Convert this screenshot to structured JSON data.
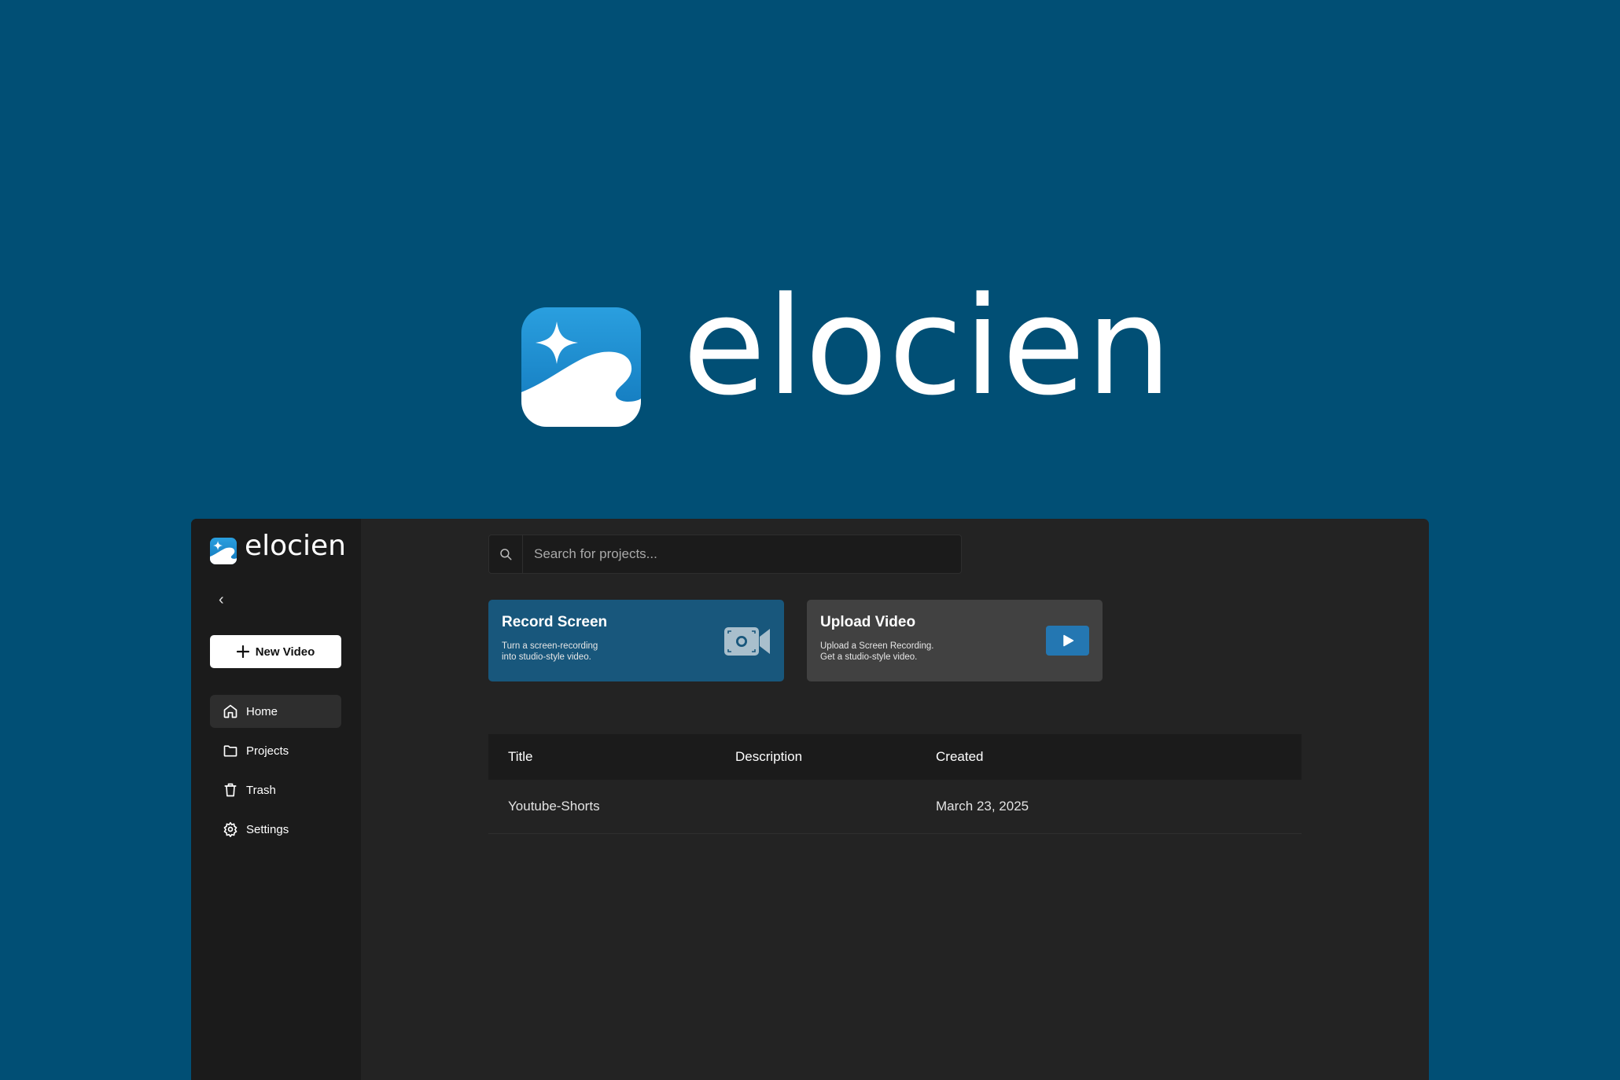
{
  "hero": {
    "brand": "elocien"
  },
  "sidebar": {
    "brand": "elocien",
    "collapse_glyph": "‹",
    "new_video_label": "New Video",
    "items": [
      {
        "label": "Home",
        "icon": "home-icon",
        "active": true
      },
      {
        "label": "Projects",
        "icon": "folder-icon",
        "active": false
      },
      {
        "label": "Trash",
        "icon": "trash-icon",
        "active": false
      },
      {
        "label": "Settings",
        "icon": "gear-icon",
        "active": false
      }
    ]
  },
  "search": {
    "placeholder": "Search for projects..."
  },
  "cards": {
    "record": {
      "title": "Record Screen",
      "desc_line1": "Turn a screen-recording",
      "desc_line2": "into studio-style video.",
      "icon": "camera-icon"
    },
    "upload": {
      "title": "Upload Video",
      "desc_line1": "Upload a Screen Recording.",
      "desc_line2": "Get a studio-style video.",
      "icon": "play-icon"
    }
  },
  "table": {
    "headers": {
      "title": "Title",
      "description": "Description",
      "created": "Created"
    },
    "rows": [
      {
        "title": "Youtube-Shorts",
        "description": "",
        "created": "March 23, 2025"
      }
    ]
  },
  "colors": {
    "background": "#014f75",
    "app_bg": "#232323",
    "sidebar_bg": "#1b1b1b",
    "record_card": "#18577c",
    "upload_card": "#414141",
    "accent": "#2477b2"
  }
}
